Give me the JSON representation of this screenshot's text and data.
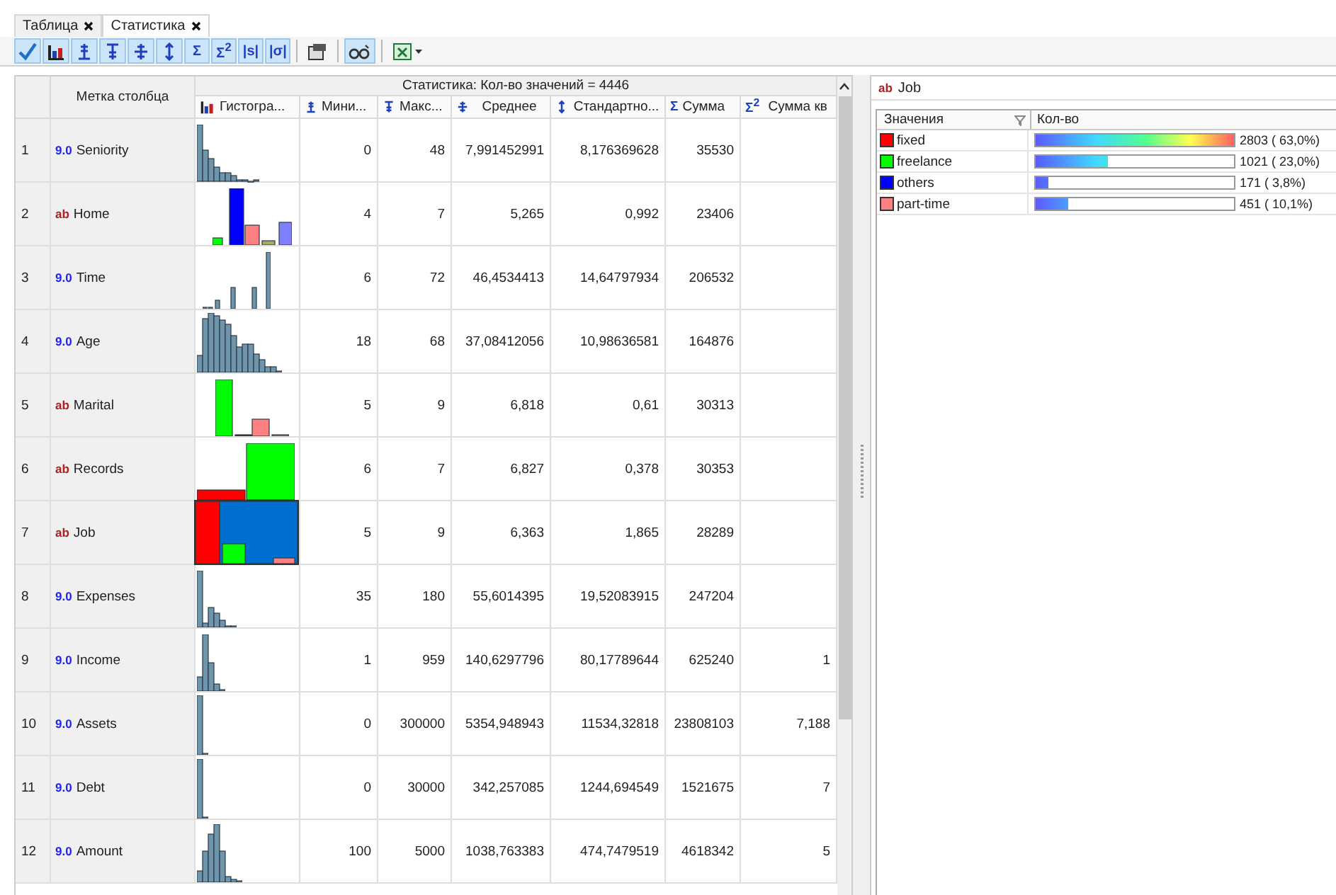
{
  "tabs": [
    {
      "label": "Таблица",
      "selected": false
    },
    {
      "label": "Статистика",
      "selected": true
    }
  ],
  "toolbar": [
    {
      "kind": "check",
      "on": true
    },
    {
      "kind": "histogram",
      "on": true
    },
    {
      "kind": "min",
      "on": true
    },
    {
      "kind": "max",
      "on": true
    },
    {
      "kind": "mean",
      "on": true
    },
    {
      "kind": "std",
      "on": true
    },
    {
      "kind": "text",
      "label": "Σ",
      "on": true
    },
    {
      "kind": "text",
      "label": "Σ$^{2}$",
      "on": true
    },
    {
      "kind": "text",
      "label": "|s|",
      "on": true
    },
    {
      "kind": "text",
      "label": "|σ|",
      "on": true
    },
    {
      "kind": "separator"
    },
    {
      "kind": "properties",
      "on": false
    },
    {
      "kind": "separator"
    },
    {
      "kind": "glasses",
      "on": true
    },
    {
      "kind": "separator"
    },
    {
      "kind": "excel",
      "on": false
    }
  ],
  "table": {
    "label_header": "Метка столбца",
    "group_header": "Статистика: Кол-во значений = 4446",
    "columns": [
      {
        "kind": "histogram",
        "label": "Гистогра..."
      },
      {
        "kind": "min",
        "label": "Мини..."
      },
      {
        "kind": "max",
        "label": "Макс..."
      },
      {
        "kind": "mean",
        "label": "Среднее"
      },
      {
        "kind": "std",
        "label": "Стандартно..."
      },
      {
        "kind": "sum",
        "icon": "Σ",
        "label": "Сумма"
      },
      {
        "kind": "sumsq",
        "icon": "Σ$^{2}$",
        "label": "Сумма кв"
      }
    ],
    "rows": [
      {
        "index": "1",
        "kind": "numeric",
        "type": "9.0",
        "name": "Seniority",
        "selected": false,
        "min": "0",
        "max": "48",
        "mean": "7,991452991",
        "std": "8,176369628",
        "sum": "35530"
      },
      {
        "index": "2",
        "kind": "text",
        "type": "ab",
        "name": "Home",
        "selected": false,
        "min": "4",
        "max": "7",
        "mean": "5,265",
        "std": "0,992",
        "sum": "23406"
      },
      {
        "index": "3",
        "kind": "numeric",
        "type": "9.0",
        "name": "Time",
        "selected": false,
        "min": "6",
        "max": "72",
        "mean": "46,4534413",
        "std": "14,64797934",
        "sum": "206532"
      },
      {
        "index": "4",
        "kind": "numeric",
        "type": "9.0",
        "name": "Age",
        "selected": false,
        "min": "18",
        "max": "68",
        "mean": "37,08412056",
        "std": "10,98636581",
        "sum": "164876"
      },
      {
        "index": "5",
        "kind": "text",
        "type": "ab",
        "name": "Marital",
        "selected": false,
        "min": "5",
        "max": "9",
        "mean": "6,818",
        "std": "0,61",
        "sum": "30313"
      },
      {
        "index": "6",
        "kind": "text",
        "type": "ab",
        "name": "Records",
        "selected": false,
        "min": "6",
        "max": "7",
        "mean": "6,827",
        "std": "0,378",
        "sum": "30353"
      },
      {
        "index": "7",
        "kind": "text",
        "type": "ab",
        "name": "Job",
        "selected": true,
        "min": "5",
        "max": "9",
        "mean": "6,363",
        "std": "1,865",
        "sum": "28289"
      },
      {
        "index": "8",
        "kind": "numeric",
        "type": "9.0",
        "name": "Expenses",
        "selected": false,
        "min": "35",
        "max": "180",
        "mean": "55,6014395",
        "std": "19,52083915",
        "sum": "247204"
      },
      {
        "index": "9",
        "kind": "numeric",
        "type": "9.0",
        "name": "Income",
        "selected": false,
        "min": "1",
        "max": "959",
        "mean": "140,6297796",
        "std": "80,17789644",
        "sum": "625240",
        "sum_sq": "1"
      },
      {
        "index": "10",
        "kind": "numeric",
        "type": "9.0",
        "name": "Assets",
        "selected": false,
        "min": "0",
        "max": "300000",
        "mean": "5354,948943",
        "std": "11534,32818",
        "sum": "23808103",
        "sum_sq": "7,188"
      },
      {
        "index": "11",
        "kind": "numeric",
        "type": "9.0",
        "name": "Debt",
        "selected": false,
        "min": "0",
        "max": "30000",
        "mean": "342,257085",
        "std": "1244,694549",
        "sum": "1521675",
        "sum_sq": "7"
      },
      {
        "index": "12",
        "kind": "numeric",
        "type": "9.0",
        "name": "Amount",
        "selected": false,
        "min": "100",
        "max": "5000",
        "mean": "1038,763383",
        "std": "474,7479519",
        "sum": "4618342",
        "sum_sq": "5"
      }
    ]
  },
  "detail": {
    "type": "ab",
    "title": "Job",
    "columns": [
      "Значения",
      "Кол-во"
    ],
    "values": [
      {
        "label": "fixed",
        "color": "#ff0000",
        "level": 1,
        "count": "2803 ( 63,0%)"
      },
      {
        "label": "freelance",
        "color": "#00ff00",
        "level": 0.364,
        "count": "1021 ( 23,0%)"
      },
      {
        "label": "others",
        "color": "#0000ff",
        "level": 0.061,
        "count": "171 (  3,8%)"
      },
      {
        "label": "part-time",
        "color": "#ff8080",
        "level": 0.161,
        "count": "451 ( 10,1%)"
      }
    ]
  }
}
